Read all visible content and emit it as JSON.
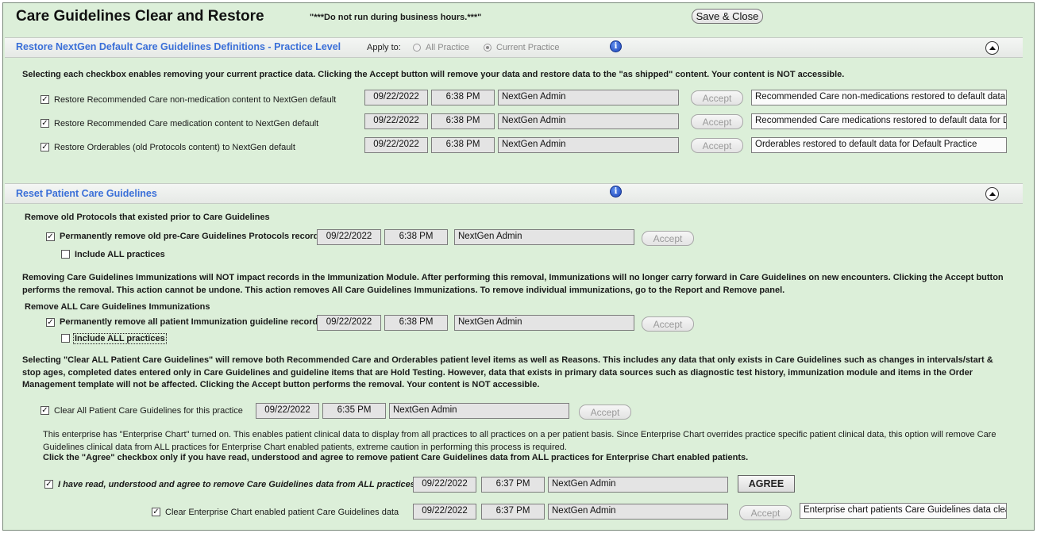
{
  "header": {
    "title": "Care Guidelines Clear and Restore",
    "warning": "\"***Do not run during business hours.***\"",
    "save_close": "Save & Close"
  },
  "restore_section": {
    "title": "Restore NextGen Default Care Guidelines Definitions - Practice Level",
    "apply_to_label": "Apply to:",
    "option_all": "All Practice",
    "option_current": "Current Practice",
    "selected_option": "Current Practice",
    "description": "Selecting each checkbox enables removing your current practice data. Clicking the Accept button will remove your data and restore data to the \"as shipped\" content. Your content is NOT accessible.",
    "rows": [
      {
        "label": "Restore Recommended Care non-medication content to NextGen default",
        "checked": true,
        "date": "09/22/2022",
        "time": "6:38 PM",
        "user": "NextGen Admin",
        "accept": "Accept",
        "result": "Recommended Care non-medications restored to default data"
      },
      {
        "label": "Restore Recommended Care medication content to NextGen default",
        "checked": true,
        "date": "09/22/2022",
        "time": "6:38 PM",
        "user": "NextGen Admin",
        "accept": "Accept",
        "result": "Recommended Care medications restored to default data for D"
      },
      {
        "label": "Restore Orderables (old Protocols content) to NextGen default",
        "checked": true,
        "date": "09/22/2022",
        "time": "6:38 PM",
        "user": "NextGen Admin",
        "accept": "Accept",
        "result": "Orderables restored to default data for Default Practice"
      }
    ]
  },
  "reset_section": {
    "title": "Reset Patient Care Guidelines",
    "protocols": {
      "heading": "Remove old Protocols that existed prior to Care Guidelines",
      "row": {
        "label": "Permanently remove old pre-Care Guidelines Protocols records",
        "checked": true,
        "date": "09/22/2022",
        "time": "6:38 PM",
        "user": "NextGen Admin",
        "accept": "Accept"
      },
      "include_all": {
        "label": "Include ALL practices",
        "checked": false
      }
    },
    "immunizations": {
      "description": "Removing Care Guidelines Immunizations will NOT impact records in the Immunization Module. After performing this removal, Immunizations will no longer carry forward in Care Guidelines on new encounters. Clicking the Accept button performs the removal. This action cannot be undone. This action removes All Care Guidelines Immunizations. To remove individual immunizations, go to the Report and Remove panel.",
      "heading": "Remove ALL Care Guidelines Immunizations",
      "row": {
        "label": "Permanently remove all patient Immunization guideline records",
        "checked": true,
        "date": "09/22/2022",
        "time": "6:38 PM",
        "user": "NextGen Admin",
        "accept": "Accept"
      },
      "include_all": {
        "label": "Include ALL practices",
        "checked": false
      }
    },
    "clear_all": {
      "description": "Selecting \"Clear ALL Patient Care Guidelines\" will remove both Recommended Care and Orderables patient level items as well as Reasons.  This includes any data that only exists in Care Guidelines such as changes in intervals/start & stop ages, completed dates entered only in Care Guidelines and guideline items that are Hold Testing. However, data that exists in primary data sources such as diagnostic test history, immunization module and items in the Order Management template will not be affected. Clicking the Accept button performs the removal.  Your content is NOT accessible.",
      "row": {
        "label": "Clear All Patient Care Guidelines for this practice",
        "checked": true,
        "date": "09/22/2022",
        "time": "6:35 PM",
        "user": "NextGen Admin",
        "accept": "Accept"
      }
    },
    "enterprise": {
      "description": "This enterprise has \"Enterprise Chart\" turned on.  This enables patient clinical data to display from all practices to all practices on a per patient basis.  Since Enterprise Chart overrides practice specific patient clinical data, this option will remove Care Guidelines clinical data from ALL practices for Enterprise Chart enabled patients, extreme caution in performing this process is required.",
      "instruction": "Click the \"Agree\" checkbox only if you have read, understood and agree to remove patient Care Guidelines data from ALL practices for Enterprise Chart enabled patients.",
      "agree_row": {
        "label": "I have read, understood and agree to remove Care Guidelines data from ALL practices",
        "checked": true,
        "date": "09/22/2022",
        "time": "6:37 PM",
        "user": "NextGen Admin",
        "button": "AGREE"
      },
      "clear_row": {
        "label": "Clear Enterprise Chart enabled patient Care Guidelines data",
        "checked": true,
        "date": "09/22/2022",
        "time": "6:37 PM",
        "user": "NextGen Admin",
        "accept": "Accept",
        "result": "Enterprise chart patients Care Guidelines data clea"
      }
    }
  }
}
